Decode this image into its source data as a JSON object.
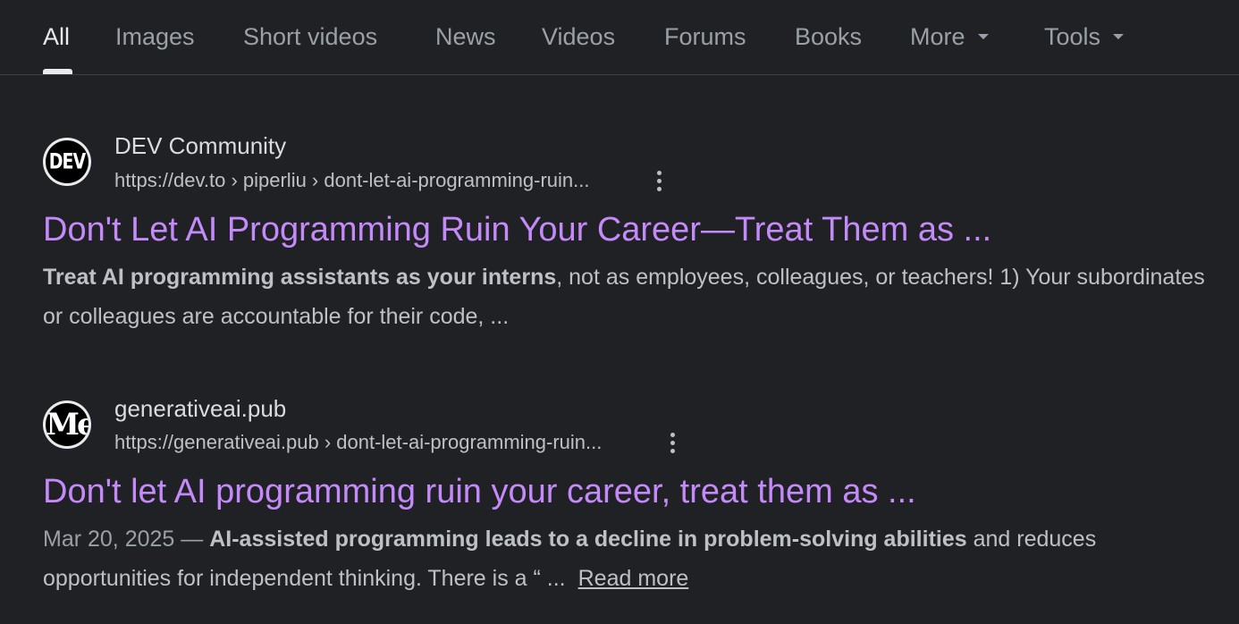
{
  "tabs": [
    {
      "label": "All",
      "active": true
    },
    {
      "label": "Images"
    },
    {
      "label": "Short videos"
    },
    {
      "label": "News"
    },
    {
      "label": "Videos"
    },
    {
      "label": "Forums"
    },
    {
      "label": "Books"
    },
    {
      "label": "More",
      "icon": "caret-down-icon"
    },
    {
      "label": "Tools",
      "icon": "caret-down-icon"
    }
  ],
  "results": [
    {
      "favicon_text": "DEV",
      "site_name": "DEV Community",
      "url": "https://dev.to › piperliu › dont-let-ai-programming-ruin...",
      "title": "Don't Let AI Programming Ruin Your Career—Treat Them as ...",
      "snippet_bold": "Treat AI programming assistants as your interns",
      "snippet_rest": ", not as employees, colleagues, or teachers! 1) Your subordinates or colleagues are accountable for their code, ..."
    },
    {
      "favicon_text": "Me",
      "site_name": "generativeai.pub",
      "url": "https://generativeai.pub › dont-let-ai-programming-ruin...",
      "title": "Don't let AI programming ruin your career, treat them as ...",
      "date": "Mar 20, 2025",
      "date_sep": " — ",
      "snippet_bold": "AI-assisted programming leads to a decline in problem-solving abilities",
      "snippet_rest": " and reduces opportunities for independent thinking. There is a “ ...",
      "read_more": "Read more"
    }
  ],
  "colors": {
    "background": "#202124",
    "link_visited": "#c58af9",
    "text": "#bdc1c6",
    "tab_active": "#e8eaed",
    "tab_inactive": "#9aa0a6"
  }
}
